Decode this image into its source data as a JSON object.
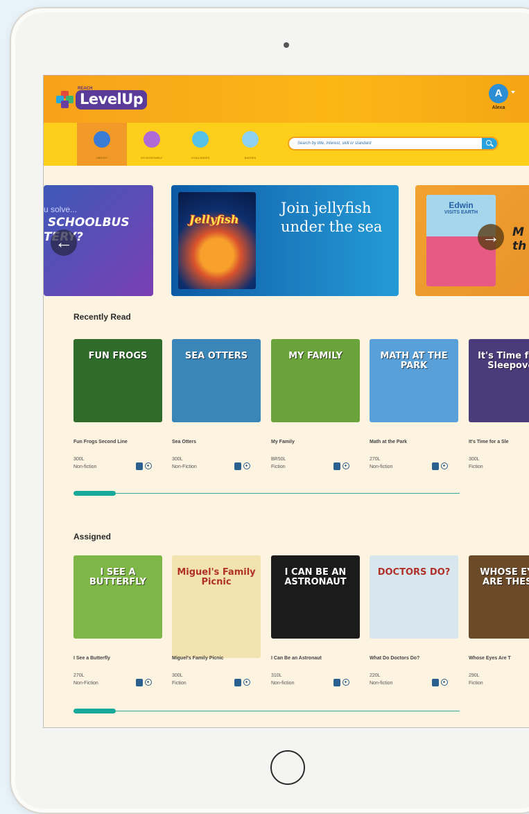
{
  "header": {
    "logo_small": "REACH",
    "logo_text": "LevelUp",
    "avatar_initial": "A",
    "avatar_name": "Alexa"
  },
  "nav": {
    "items": [
      {
        "label": "LIBRARY",
        "color": "#3a7bd5"
      },
      {
        "label": "MY BOOKSHELF",
        "color": "#b06ad6"
      },
      {
        "label": "CHALLENGES",
        "color": "#56c1e8"
      },
      {
        "label": "BADGES",
        "color": "#8dd0ef"
      }
    ],
    "search_placeholder": "Search by title, interest, skill or standard"
  },
  "banners": {
    "left_small": "u solve...",
    "left_title": " SCHOOLBUS\nTERY?",
    "center_book": "Jellyfish",
    "center_text": "Join jellyfish under the sea",
    "right_book_title": "Edwin",
    "right_book_sub": "VISITS EARTH",
    "right_text": "M\nth"
  },
  "recently_read": {
    "title": "Recently Read",
    "progress": 0.11,
    "books": [
      {
        "cover": "FUN FROGS",
        "title": "Fun Frogs Second Line",
        "level": "300L",
        "genre": "Non-fiction",
        "color": "#2f6b2a"
      },
      {
        "cover": "SEA OTTERS",
        "title": "Sea Otters",
        "level": "300L",
        "genre": "Non-Fiction",
        "color": "#3b86b8"
      },
      {
        "cover": "MY FAMILY",
        "title": "My Family",
        "level": "BR50L",
        "genre": "Fiction",
        "color": "#6aa33a"
      },
      {
        "cover": "MATH AT THE PARK",
        "title": "Math at the Park",
        "level": "270L",
        "genre": "Non-fiction",
        "color": "#5aa0d8"
      },
      {
        "cover": "It's Time for a Sleepover",
        "title": "It's Time for a Sle",
        "level": "300L",
        "genre": "Fiction",
        "color": "#4a3b7a"
      }
    ]
  },
  "assigned": {
    "title": "Assigned",
    "progress": 0.11,
    "books": [
      {
        "cover": "I SEE A BUTTERFLY",
        "title": "I See a Butterfly",
        "level": "270L",
        "genre": "Non-Fiction",
        "color": "#7fb648"
      },
      {
        "cover": "Miguel's Family Picnic",
        "title": "Miguel's Family Picnic",
        "level": "300L",
        "genre": "Fiction",
        "color": "#f2e3b0"
      },
      {
        "cover": "I CAN BE AN ASTRONAUT",
        "title": "I Can Be an Astronaut",
        "level": "310L",
        "genre": "Non-fiction",
        "color": "#1b1b1b"
      },
      {
        "cover": "DOCTORS DO?",
        "title": "What Do Doctors Do?",
        "level": "220L",
        "genre": "Non-fiction",
        "color": "#d8e6ee"
      },
      {
        "cover": "WHOSE EYES ARE THESE?",
        "title": "Whose Eyes Are T",
        "level": "290L",
        "genre": "Fiction",
        "color": "#6b4a2a"
      }
    ]
  }
}
